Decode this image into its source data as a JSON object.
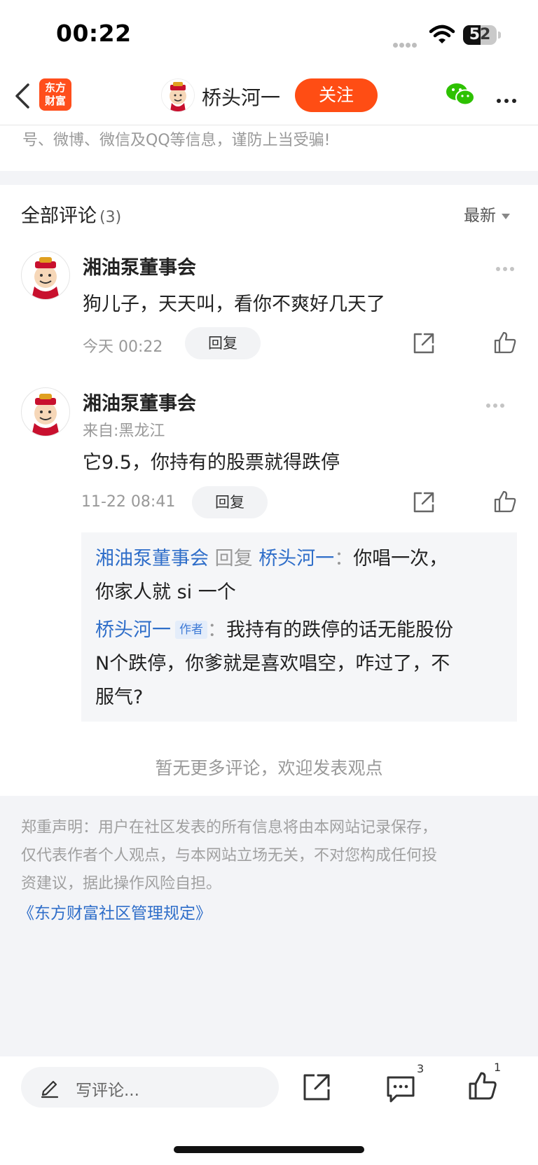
{
  "status_bar": {
    "time": "00:22",
    "battery": "52",
    "battery_level": 0.52
  },
  "nav": {
    "logo_line1": "东方",
    "logo_line2": "财富",
    "user_name": "桥头河一",
    "follow_label": "关注"
  },
  "warning_text": "号、微博、微信及QQ等信息，谨防上当受骗!",
  "comments": {
    "title": "全部评论",
    "count": "(3)",
    "sort_label": "最新",
    "items": [
      {
        "user": "湘油泵董事会",
        "text": "狗儿子，天天叫，看你不爽好几天了",
        "time": "今天 00:22",
        "reply_label": "回复"
      },
      {
        "user": "湘油泵董事会",
        "from": "来自:黑龙江",
        "text": "它9.5，你持有的股票就得跌停",
        "time": "11-22 08:41",
        "reply_label": "回复",
        "replies": [
          {
            "from_user": "湘油泵董事会",
            "reply_word": "回复",
            "to_user": "桥头河一",
            "sep": "：",
            "text_line1": "你唱一次，",
            "text_line2": "你家人就 si 一个"
          },
          {
            "from_user": "桥头河一",
            "author_tag": "作者",
            "sep": "：",
            "text_line1": "我持有的跌停的话无能股份",
            "text_line2": "N个跌停，你爹就是喜欢唱空，咋过了，不",
            "text_line3": "服气?"
          }
        ]
      }
    ],
    "no_more": "暂无更多评论，欢迎发表观点"
  },
  "footer": {
    "disclaimer_line1": "郑重声明：用户在社区发表的所有信息将由本网站记录保存，",
    "disclaimer_line2": "仅代表作者个人观点，与本网站立场无关，不对您构成任何投",
    "disclaimer_line3": "资建议，据此操作风险自担。",
    "rules_link": "《东方财富社区管理规定》"
  },
  "bottom_bar": {
    "comment_placeholder": "写评论...",
    "comment_count": "3",
    "like_count": "1"
  },
  "colors": {
    "accent": "#ff4d14",
    "link": "#2f6ec9",
    "footer_bg": "#f3f4f7"
  }
}
